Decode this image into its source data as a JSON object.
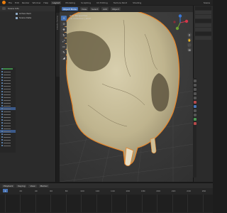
{
  "topbar": {
    "menus": [
      "File",
      "Edit",
      "Render",
      "Window",
      "Help"
    ],
    "workspace_tabs": [
      "Layout",
      "Modeling",
      "Sculpting",
      "UV Editing",
      "Texture Paint",
      "Shading"
    ],
    "scene_name": "Scene"
  },
  "left_panel": {
    "header_title": "Scene Info",
    "rows": [
      {
        "label": "Active Item"
      },
      {
        "label": "Scene Data"
      }
    ],
    "side_tab_label": "Overlay Options"
  },
  "viewport": {
    "header_buttons": [
      "Object Mode",
      "View",
      "Select",
      "Add",
      "Object"
    ],
    "overlay_lines": [
      "User Perspective",
      "(1) Collection | skull"
    ],
    "tools": [
      "+",
      "⊙",
      "✥",
      "↻",
      "⤢",
      "▭",
      "✎",
      "◢"
    ],
    "nav_buttons": [
      "⚲",
      "✋",
      "🎥",
      "⊞"
    ],
    "gizmo": {
      "x_color": "#d4364a",
      "y_color": "#6fa132",
      "z_color": "#3a78d6"
    }
  },
  "timeline": {
    "header_buttons": [
      "Playback",
      "Keying",
      "View",
      "Marker"
    ],
    "ticks": [
      "0",
      "20",
      "40",
      "60",
      "80",
      "100",
      "120",
      "140",
      "160",
      "180",
      "200",
      "220",
      "240",
      "260"
    ],
    "current_frame": "1"
  },
  "colors": {
    "accent": "#4772b3",
    "selection_outline": "#e8862a",
    "bone": "#c9bf9c"
  }
}
